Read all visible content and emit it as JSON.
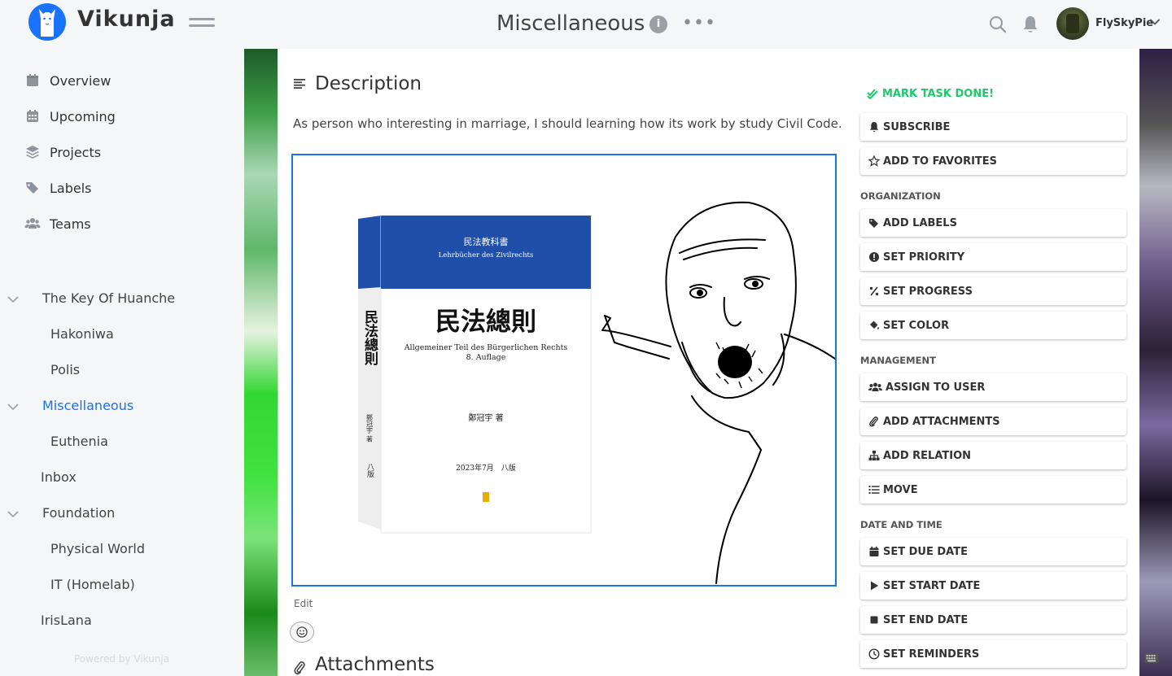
{
  "app": {
    "brand": "Vikunja",
    "page_title": "Miscellaneous",
    "username": "FlySkyPie"
  },
  "sidebar": {
    "nav": [
      {
        "label": "Overview",
        "icon": "calendar-icon"
      },
      {
        "label": "Upcoming",
        "icon": "calendar-grid-icon"
      },
      {
        "label": "Projects",
        "icon": "layers-icon"
      },
      {
        "label": "Labels",
        "icon": "tags-icon"
      },
      {
        "label": "Teams",
        "icon": "users-icon"
      }
    ],
    "projects": [
      {
        "label": "The Key Of Huanche",
        "level": 0,
        "expandable": true
      },
      {
        "label": "Hakoniwa",
        "level": 1
      },
      {
        "label": "Polis",
        "level": 1
      },
      {
        "label": "Miscellaneous",
        "level": 0,
        "expandable": true,
        "active": true
      },
      {
        "label": "Euthenia",
        "level": 1
      },
      {
        "label": "Inbox",
        "level": 0
      },
      {
        "label": "Foundation",
        "level": 0,
        "expandable": true
      },
      {
        "label": "Physical World",
        "level": 1
      },
      {
        "label": "IT (Homelab)",
        "level": 1
      },
      {
        "label": "IrisLana",
        "level": 0
      }
    ],
    "powered_by": "Powered by Vikunja"
  },
  "description": {
    "heading": "Description",
    "text": "As person who interesting in marriage, I should learning how its work by study Civil Code.",
    "edit_label": "Edit"
  },
  "book": {
    "series_cn": "民法教科書",
    "series_de": "Lehrbücher des Zivilrechts",
    "title_cn": "民法總則",
    "subtitle_de": "Allgemeiner Teil des Bürgerlichen Rechts",
    "edition": "8. Auflage",
    "author": "鄭冠宇 著",
    "date": "2023年7月　八版",
    "spine_title": "民法總則",
    "spine_author": "鄭冠宇 著",
    "spine_edition": "八版"
  },
  "attachments": {
    "heading": "Attachments"
  },
  "actions": {
    "mark_done": "MARK TASK DONE!",
    "top": [
      {
        "label": "SUBSCRIBE",
        "icon": "bell-icon"
      },
      {
        "label": "ADD TO FAVORITES",
        "icon": "star-icon"
      }
    ],
    "organization_label": "ORGANIZATION",
    "organization": [
      {
        "label": "ADD LABELS",
        "icon": "tags-icon"
      },
      {
        "label": "SET PRIORITY",
        "icon": "exclamation-icon"
      },
      {
        "label": "SET PROGRESS",
        "icon": "percent-icon"
      },
      {
        "label": "SET COLOR",
        "icon": "fill-drip-icon"
      }
    ],
    "management_label": "MANAGEMENT",
    "management": [
      {
        "label": "ASSIGN TO USER",
        "icon": "users-icon"
      },
      {
        "label": "ADD ATTACHMENTS",
        "icon": "paperclip-icon"
      },
      {
        "label": "ADD RELATION",
        "icon": "sitemap-icon"
      },
      {
        "label": "MOVE",
        "icon": "list-icon"
      }
    ],
    "date_label": "DATE AND TIME",
    "date": [
      {
        "label": "SET DUE DATE",
        "icon": "calendar-icon"
      },
      {
        "label": "SET START DATE",
        "icon": "play-icon"
      },
      {
        "label": "SET END DATE",
        "icon": "stop-icon"
      },
      {
        "label": "SET REMINDERS",
        "icon": "clock-icon"
      }
    ]
  },
  "colors": {
    "accent": "#1973ff",
    "done_green": "#1ec96b",
    "book_blue": "#1f4fa8"
  }
}
